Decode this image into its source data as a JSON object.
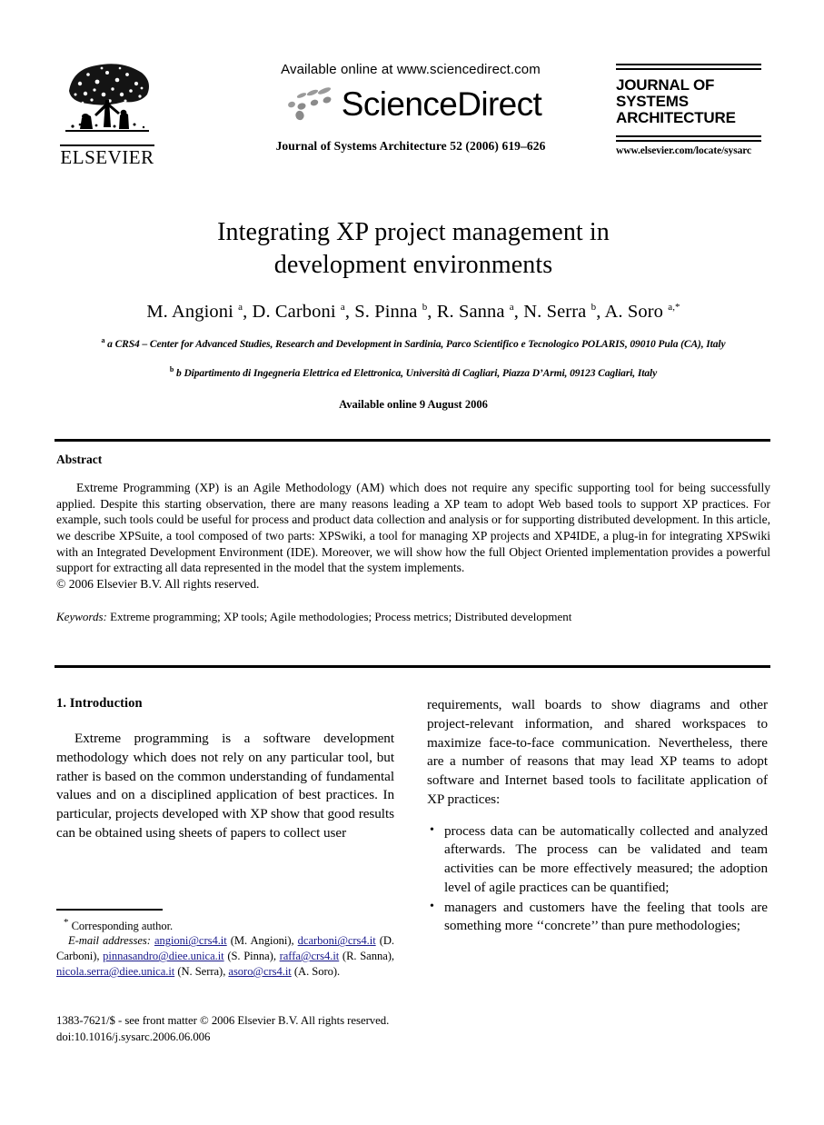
{
  "publisher": {
    "name": "ELSEVIER",
    "logo_icon": "elsevier-tree-logo"
  },
  "sciencedirect": {
    "available_line": "Available online at www.sciencedirect.com",
    "wordmark": "ScienceDirect",
    "logo_icon": "sciencedirect-swoosh-icon",
    "journal_reference": "Journal of Systems Architecture 52 (2006) 619–626"
  },
  "journal_logo": {
    "line1": "JOURNAL OF",
    "line2": "SYSTEMS",
    "line3": "ARCHITECTURE",
    "url": "www.elsevier.com/locate/sysarc"
  },
  "article": {
    "title_line1": "Integrating XP project management in",
    "title_line2": "development environments",
    "authors": "M. Angioni a, D. Carboni a, S. Pinna b, R. Sanna a, N. Serra b, A. Soro a,*",
    "affiliation_a": "a CRS4 – Center for Advanced Studies, Research and Development in Sardinia, Parco Scientifico e Tecnologico POLARIS, 09010 Pula (CA), Italy",
    "affiliation_b": "b Dipartimento di Ingegneria Elettrica ed Elettronica, Università di Cagliari, Piazza D’Armi, 09123 Cagliari, Italy",
    "available_online": "Available online 9 August 2006"
  },
  "abstract": {
    "heading": "Abstract",
    "body": "Extreme Programming (XP) is an Agile Methodology (AM) which does not require any specific supporting tool for being successfully applied. Despite this starting observation, there are many reasons leading a XP team to adopt Web based tools to support XP practices. For example, such tools could be useful for process and product data collection and analysis or for supporting distributed development. In this article, we describe XPSuite, a tool composed of two parts: XPSwiki, a tool for managing XP projects and XP4IDE, a plug-in for integrating XPSwiki with an Integrated Development Environment (IDE). Moreover, we will show how the full Object Oriented implementation provides a powerful support for extracting all data represented in the model that the system implements.",
    "copyright": "© 2006 Elsevier B.V. All rights reserved.",
    "keywords_label": "Keywords:",
    "keywords_value": "Extreme programming; XP tools; Agile methodologies; Process metrics; Distributed development"
  },
  "section": {
    "heading": "1. Introduction",
    "paragraph_left": "Extreme programming is a software development methodology which does not rely on any particular tool, but rather is based on the common understanding of fundamental values and on a disciplined application of best practices. In particular, projects developed with XP show that good results can be obtained using sheets of papers to collect user",
    "paragraph_right": "requirements, wall boards to show diagrams and other project-relevant information, and shared workspaces to maximize face-to-face communication. Nevertheless, there are a number of reasons that may lead XP teams to adopt software and Internet based tools to facilitate application of XP practices:",
    "bullets": [
      "process data can be automatically collected and analyzed afterwards. The process can be validated and team activities can be more effectively measured; the adoption level of agile practices can be quantified;",
      "managers and customers have the feeling that tools are something more ‘‘concrete’’ than pure methodologies;"
    ]
  },
  "footnote": {
    "corresponding_marker": "*",
    "corresponding_text": "Corresponding author.",
    "email_label": "E-mail addresses:",
    "emails": [
      {
        "address": "angioni@crs4.it",
        "person": "(M. Angioni)"
      },
      {
        "address": "dcarboni@crs4.it",
        "person": "(D. Carboni)"
      },
      {
        "address": "pinnasandro@diee.unica.it",
        "person": "(S. Pinna)"
      },
      {
        "address": "raffa@crs4.it",
        "person": "(R. Sanna)"
      },
      {
        "address": "nicola.serra@diee.unica.it",
        "person": "(N. Serra)"
      },
      {
        "address": "asoro@crs4.it",
        "person": "(A. Soro)"
      }
    ]
  },
  "footer": {
    "issn_line": "1383-7621/$ - see front matter © 2006 Elsevier B.V. All rights reserved.",
    "doi_line": "doi:10.1016/j.sysarc.2006.06.006"
  },
  "colors": {
    "text": "#000000",
    "link": "#1a1a8c",
    "page_background": "#ffffff",
    "swoosh_gray": "#8c8c8c"
  }
}
